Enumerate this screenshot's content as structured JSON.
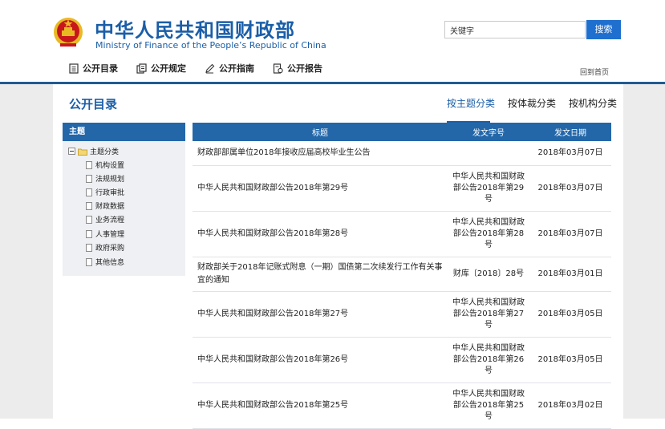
{
  "header": {
    "site_name_cn": "中华人民共和国财政部",
    "site_name_en": "Ministry of Finance of the People’s Republic of China",
    "search": {
      "value": "关键字",
      "button": "搜索"
    },
    "nav": [
      {
        "label": "公开目录",
        "icon": "catalog-icon"
      },
      {
        "label": "公开规定",
        "icon": "rules-icon"
      },
      {
        "label": "公开指南",
        "icon": "guide-pen-icon"
      },
      {
        "label": "公开报告",
        "icon": "report-icon"
      }
    ],
    "home_link": "回到首页"
  },
  "main": {
    "title": "公开目录",
    "tabs": [
      {
        "label": "按主题分类",
        "active": true
      },
      {
        "label": "按体裁分类",
        "active": false
      },
      {
        "label": "按机构分类",
        "active": false
      }
    ]
  },
  "sidebar": {
    "header": "主题",
    "root": "主题分类",
    "items": [
      "机构设置",
      "法规规划",
      "行政审批",
      "财政数据",
      "业务流程",
      "人事管理",
      "政府采购",
      "其他信息"
    ]
  },
  "table": {
    "columns": [
      "标题",
      "发文字号",
      "发文日期"
    ],
    "rows": [
      {
        "title": "财政部部属单位2018年接收应届高校毕业生公告",
        "number": "",
        "date": "2018年03月07日"
      },
      {
        "title": "中华人民共和国财政部公告2018年第29号",
        "number": "中华人民共和国财政部公告2018年第29号",
        "date": "2018年03月07日"
      },
      {
        "title": "中华人民共和国财政部公告2018年第28号",
        "number": "中华人民共和国财政部公告2018年第28号",
        "date": "2018年03月07日"
      },
      {
        "title": "财政部关于2018年记账式附息（一期）国债第二次续发行工作有关事宜的通知",
        "number": "财库〔2018〕28号",
        "date": "2018年03月01日"
      },
      {
        "title": "中华人民共和国财政部公告2018年第27号",
        "number": "中华人民共和国财政部公告2018年第27号",
        "date": "2018年03月05日"
      },
      {
        "title": "中华人民共和国财政部公告2018年第26号",
        "number": "中华人民共和国财政部公告2018年第26号",
        "date": "2018年03月05日"
      },
      {
        "title": "中华人民共和国财政部公告2018年第25号",
        "number": "中华人民共和国财政部公告2018年第25号",
        "date": "2018年03月02日"
      }
    ]
  },
  "colors": {
    "brand_blue": "#1a5ea8",
    "header_blue": "#2367a9",
    "button_blue": "#1f6fcf",
    "emblem_red": "#c8161d",
    "emblem_gold": "#e8b923"
  }
}
